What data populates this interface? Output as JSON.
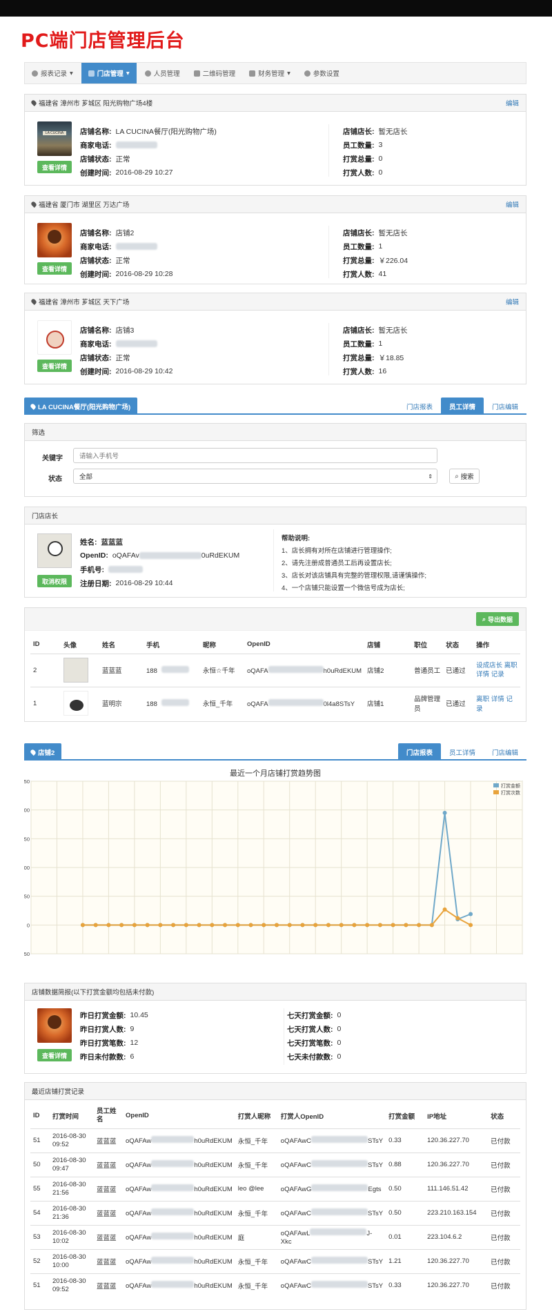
{
  "page_title": "PC端门店管理后台",
  "nav": {
    "items": [
      {
        "label": "报表记录",
        "caret": "▾"
      },
      {
        "label": "门店管理",
        "caret": "▾"
      },
      {
        "label": "人员管理",
        "caret": ""
      },
      {
        "label": "二维码管理",
        "caret": ""
      },
      {
        "label": "财务管理",
        "caret": "▾"
      },
      {
        "label": "参数设置",
        "caret": ""
      }
    ],
    "active_index": 1
  },
  "labels": {
    "edit": "编辑",
    "view_detail": "查看详情",
    "store_name": "店铺名称:",
    "merchant_phone": "商家电话:",
    "store_status": "店铺状态:",
    "create_time": "创建时间:",
    "store_manager": "店铺店长:",
    "staff_count": "员工数量:",
    "tip_total": "打赏总量:",
    "tip_people": "打赏人数:"
  },
  "stores": [
    {
      "address": "福建省 漳州市 芗城区 阳光购物广场4楼",
      "name": "LA CUCINA餐厅(阳光购物广场)",
      "status": "正常",
      "created": "2016-08-29 10:27",
      "manager": "暂无店长",
      "staff": "3",
      "tip_total": "0",
      "tip_people": "0"
    },
    {
      "address": "福建省 厦门市 湖里区 万达广场",
      "name": "店铺2",
      "status": "正常",
      "created": "2016-08-29 10:28",
      "manager": "暂无店长",
      "staff": "1",
      "tip_total": "￥226.04",
      "tip_people": "41"
    },
    {
      "address": "福建省 漳州市 芗城区 天下广场",
      "name": "店铺3",
      "status": "正常",
      "created": "2016-08-29 10:42",
      "manager": "暂无店长",
      "staff": "1",
      "tip_total": "￥18.85",
      "tip_people": "16"
    }
  ],
  "detail_tabs": {
    "title": "LA CUCINA餐厅(阳光购物广场)",
    "tabs": [
      "门店报表",
      "员工详情",
      "门店编辑"
    ],
    "active": 1
  },
  "filter": {
    "title": "筛选",
    "keyword_label": "关键字",
    "keyword_placeholder": "请输入手机号",
    "status_label": "状态",
    "status_value": "全部",
    "search_button": "搜索"
  },
  "manager_panel": {
    "title": "门店店长",
    "name_label": "姓名:",
    "name": "蓝蓝蓝",
    "openid_label": "OpenID:",
    "openid_prefix": "oQAFAv",
    "openid_suffix": "0uRdEKUM",
    "phone_label": "手机号:",
    "reg_label": "注册日期:",
    "reg_date": "2016-08-29 10:44",
    "cancel_button": "取消权限",
    "help_title": "帮助说明:",
    "help_lines": [
      "1、店长拥有对所在店铺进行管理操作;",
      "2、请先注册成普通员工后再设置店长;",
      "3、店长对该店铺具有完整的管理权限,请谨慎操作;",
      "4、一个店铺只能设置一个微信号成为店长;"
    ]
  },
  "staff_table": {
    "export_button": "导出数据",
    "headers": [
      "ID",
      "头像",
      "姓名",
      "手机",
      "昵称",
      "OpenID",
      "店铺",
      "职位",
      "状态",
      "操作"
    ],
    "rows": [
      {
        "id": "2",
        "name": "蓝蓝蓝",
        "phone": "188",
        "nick": "永恒☆千年",
        "openid_a": "oQAFA",
        "openid_b": "h0uRdEKUM",
        "store": "店铺2",
        "position": "普通员工",
        "status": "已通过",
        "actions": [
          "设成店长",
          "离职",
          "详情",
          "记录"
        ]
      },
      {
        "id": "1",
        "name": "蓝明宗",
        "phone": "188",
        "nick": "永恒_千年",
        "openid_a": "oQAFA",
        "openid_b": "0l4a8STsY",
        "store": "店铺1",
        "position": "品牌管理员",
        "status": "已通过",
        "actions": [
          "离职",
          "详情",
          "记录"
        ]
      }
    ]
  },
  "report_tabs": {
    "title": "店铺2",
    "tabs": [
      "门店报表",
      "员工详情",
      "门店编辑"
    ],
    "active": 0
  },
  "chart_data": {
    "type": "line",
    "title": "最近一个月店铺打赏趋势图",
    "xlim": [
      -4,
      34
    ],
    "ylim": [
      -50,
      250
    ],
    "xticks": [
      -4,
      -2,
      0,
      2,
      4,
      6,
      8,
      10,
      12,
      14,
      16,
      18,
      20,
      22,
      24,
      26,
      28,
      30,
      32,
      34
    ],
    "yticks": [
      -50,
      0,
      50,
      100,
      150,
      200,
      250
    ],
    "grid": true,
    "legend": "top-right",
    "x": [
      0,
      1,
      2,
      3,
      4,
      5,
      6,
      7,
      8,
      9,
      10,
      11,
      12,
      13,
      14,
      15,
      16,
      17,
      18,
      19,
      20,
      21,
      22,
      23,
      24,
      25,
      26,
      27,
      28,
      29,
      30
    ],
    "series": [
      {
        "name": "打赏金额",
        "color": "#6fa8c9",
        "values": [
          0,
          0,
          0,
          0,
          0,
          0,
          0,
          0,
          0,
          0,
          0,
          0,
          0,
          0,
          0,
          0,
          0,
          0,
          0,
          0,
          0,
          0,
          0,
          0,
          0,
          0,
          0,
          0,
          195,
          10,
          19
        ]
      },
      {
        "name": "打赏次数",
        "color": "#e8a33b",
        "values": [
          0,
          0,
          0,
          0,
          0,
          0,
          0,
          0,
          0,
          0,
          0,
          0,
          0,
          0,
          0,
          0,
          0,
          0,
          0,
          0,
          0,
          0,
          0,
          0,
          0,
          0,
          0,
          0,
          27,
          12,
          0
        ]
      }
    ]
  },
  "summary": {
    "title": "店铺数据简报(以下打赏金额均包括未付款)",
    "view_button": "查看详情",
    "left": [
      {
        "label": "昨日打赏金额:",
        "value": "10.45"
      },
      {
        "label": "昨日打赏人数:",
        "value": "9"
      },
      {
        "label": "昨日打赏笔数:",
        "value": "12"
      },
      {
        "label": "昨日未付款数:",
        "value": "6"
      }
    ],
    "right": [
      {
        "label": "七天打赏金额:",
        "value": "0"
      },
      {
        "label": "七天打赏人数:",
        "value": "0"
      },
      {
        "label": "七天打赏笔数:",
        "value": "0"
      },
      {
        "label": "七天未付款数:",
        "value": "0"
      }
    ]
  },
  "records": {
    "title": "最近店铺打赏记录",
    "headers": [
      "ID",
      "打赏时间",
      "员工姓名",
      "OpenID",
      "打赏人昵称",
      "打赏人OpenID",
      "打赏金额",
      "IP地址",
      "状态"
    ],
    "rows": [
      {
        "id": "51",
        "date": "2016-08-30",
        "time": "09:52",
        "staff": "蓝蓝蓝",
        "oa": "oQAFAw",
        "ob": "h0uRdEKUM",
        "nick": "永恒_千年",
        "pa": "oQAFAwC",
        "pb": "STsY",
        "amount": "0.33",
        "ip": "120.36.227.70",
        "status": "已付款"
      },
      {
        "id": "50",
        "date": "2016-08-30",
        "time": "09:47",
        "staff": "蓝蓝蓝",
        "oa": "oQAFAw",
        "ob": "h0uRdEKUM",
        "nick": "永恒_千年",
        "pa": "oQAFAwC",
        "pb": "STsY",
        "amount": "0.88",
        "ip": "120.36.227.70",
        "status": "已付款"
      },
      {
        "id": "55",
        "date": "2016-08-30",
        "time": "21:56",
        "staff": "蓝蓝蓝",
        "oa": "oQAFAw",
        "ob": "h0uRdEKUM",
        "nick": "leo @lee",
        "pa": "oQAFAwG",
        "pb": "Egts",
        "amount": "0.50",
        "ip": "111.146.51.42",
        "status": "已付款"
      },
      {
        "id": "54",
        "date": "2016-08-30",
        "time": "21:36",
        "staff": "蓝蓝蓝",
        "oa": "oQAFAw",
        "ob": "h0uRdEKUM",
        "nick": "永恒_千年",
        "pa": "oQAFAwC",
        "pb": "STsY",
        "amount": "0.50",
        "ip": "223.210.163.154",
        "status": "已付款"
      },
      {
        "id": "53",
        "date": "2016-08-30",
        "time": "10:02",
        "staff": "蓝蓝蓝",
        "oa": "oQAFAw",
        "ob": "h0uRdEKUM",
        "nick": "庭",
        "pa": "oQAFAwL",
        "pb": "J-",
        "pc": "Xkc",
        "amount": "0.01",
        "ip": "223.104.6.2",
        "status": "已付款"
      },
      {
        "id": "52",
        "date": "2016-08-30",
        "time": "10:00",
        "staff": "蓝蓝蓝",
        "oa": "oQAFAw",
        "ob": "h0uRdEKUM",
        "nick": "永恒_千年",
        "pa": "oQAFAwC",
        "pb": "STsY",
        "amount": "1.21",
        "ip": "120.36.227.70",
        "status": "已付款"
      },
      {
        "id": "51",
        "date": "2016-08-30",
        "time": "09:52",
        "staff": "蓝蓝蓝",
        "oa": "oQAFAw",
        "ob": "h0uRdEKUM",
        "nick": "永恒_千年",
        "pa": "oQAFAwC",
        "pb": "STsY",
        "amount": "0.33",
        "ip": "120.36.227.70",
        "status": "已付款"
      }
    ]
  }
}
